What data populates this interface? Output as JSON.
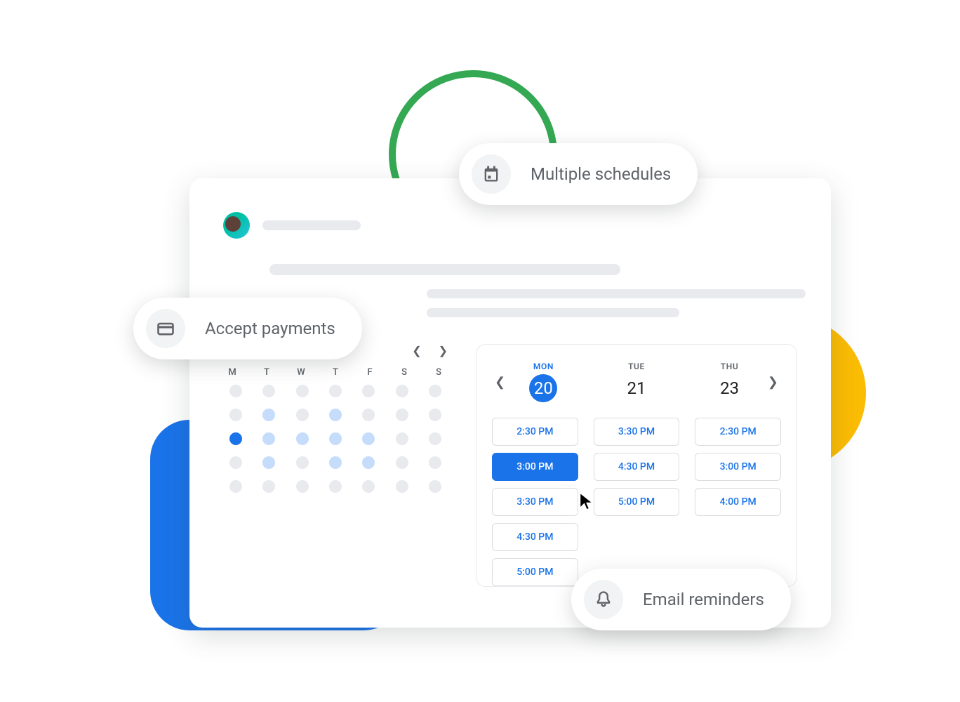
{
  "features": {
    "schedules_label": "Multiple schedules",
    "payments_label": "Accept payments",
    "reminders_label": "Email reminders"
  },
  "mini_calendar": {
    "weekday_labels": [
      "M",
      "T",
      "W",
      "T",
      "F",
      "S",
      "S"
    ],
    "rows": [
      [
        "grey",
        "grey",
        "grey",
        "grey",
        "grey",
        "grey",
        "grey"
      ],
      [
        "grey",
        "light-blue",
        "grey",
        "light-blue",
        "grey",
        "grey",
        "grey"
      ],
      [
        "blue-solid",
        "light-blue",
        "light-blue",
        "light-blue",
        "light-blue",
        "grey",
        "grey"
      ],
      [
        "grey",
        "light-blue",
        "grey",
        "light-blue",
        "light-blue",
        "grey",
        "grey"
      ],
      [
        "grey",
        "grey",
        "grey",
        "grey",
        "grey",
        "grey",
        "grey"
      ]
    ]
  },
  "days": {
    "columns": [
      {
        "weekday": "MON",
        "num": "20",
        "active": true
      },
      {
        "weekday": "TUE",
        "num": "21",
        "active": false
      },
      {
        "weekday": "THU",
        "num": "23",
        "active": false
      }
    ]
  },
  "slots": {
    "col0": [
      "2:30 PM",
      "3:00 PM",
      "3:30 PM",
      "4:30 PM",
      "5:00 PM"
    ],
    "col1": [
      "3:30 PM",
      "4:30 PM",
      "5:00 PM"
    ],
    "col2": [
      "2:30 PM",
      "3:00 PM",
      "4:00 PM"
    ],
    "selected": {
      "col": 0,
      "index": 1
    }
  }
}
